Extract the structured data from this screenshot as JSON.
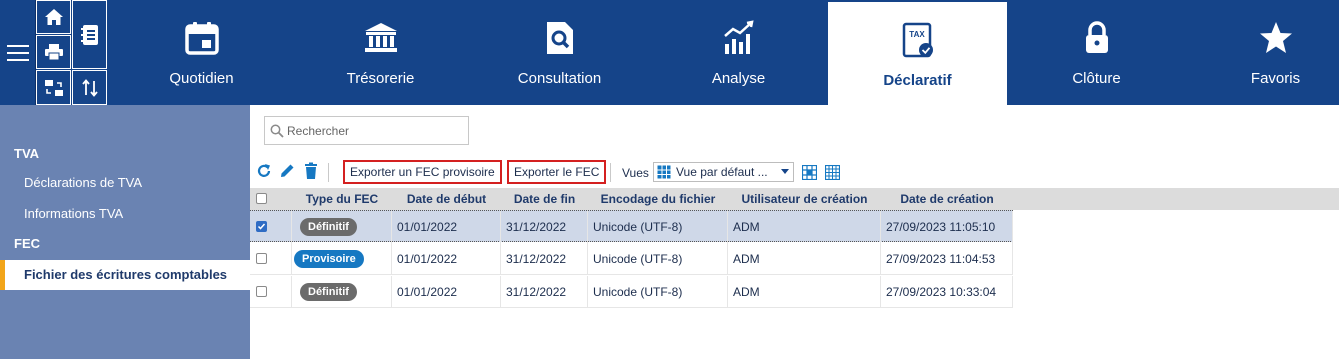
{
  "nav": {
    "items": [
      {
        "label": "Quotidien",
        "icon": "calendar-icon"
      },
      {
        "label": "Trésorerie",
        "icon": "bank-icon"
      },
      {
        "label": "Consultation",
        "icon": "document-search-icon"
      },
      {
        "label": "Analyse",
        "icon": "bar-chart-icon"
      },
      {
        "label": "Déclaratif",
        "icon": "tax-icon"
      },
      {
        "label": "Clôture",
        "icon": "lock-icon"
      },
      {
        "label": "Favoris",
        "icon": "star-icon"
      }
    ],
    "active": "Déclaratif",
    "tax_icon_text": "TAX"
  },
  "quick": [
    "home-icon",
    "address-book-icon",
    "print-icon",
    "transfer-icon",
    "swap-arrows-icon"
  ],
  "sidebar": {
    "sections": [
      {
        "title": "TVA",
        "items": [
          "Déclarations de TVA",
          "Informations TVA"
        ]
      },
      {
        "title": "FEC",
        "items": [
          "Fichier des écritures comptables"
        ]
      }
    ]
  },
  "search": {
    "placeholder": "Rechercher"
  },
  "toolbar": {
    "export_provisional": "Exporter un FEC provisoire",
    "export_fec": "Exporter le FEC",
    "views_label": "Vues",
    "views_value": "Vue par défaut ..."
  },
  "table": {
    "columns": [
      "Type du FEC",
      "Date de début",
      "Date de fin",
      "Encodage du fichier",
      "Utilisateur de création",
      "Date de création"
    ],
    "rows": [
      {
        "selected": true,
        "type": "Définitif",
        "start": "01/01/2022",
        "end": "31/12/2022",
        "encoding": "Unicode (UTF-8)",
        "user": "ADM",
        "created": "27/09/2023 11:05:10"
      },
      {
        "selected": false,
        "type": "Provisoire",
        "start": "01/01/2022",
        "end": "31/12/2022",
        "encoding": "Unicode (UTF-8)",
        "user": "ADM",
        "created": "27/09/2023 11:04:53"
      },
      {
        "selected": false,
        "type": "Définitif",
        "start": "01/01/2022",
        "end": "31/12/2022",
        "encoding": "Unicode (UTF-8)",
        "user": "ADM",
        "created": "27/09/2023 10:33:04"
      }
    ]
  },
  "colors": {
    "brand": "#154489",
    "sidebar": "#6a83b2",
    "accent": "#f2a51a",
    "highlight": "#d42020",
    "badge_final": "#6b6b6b",
    "badge_provisional": "#1678c2"
  }
}
